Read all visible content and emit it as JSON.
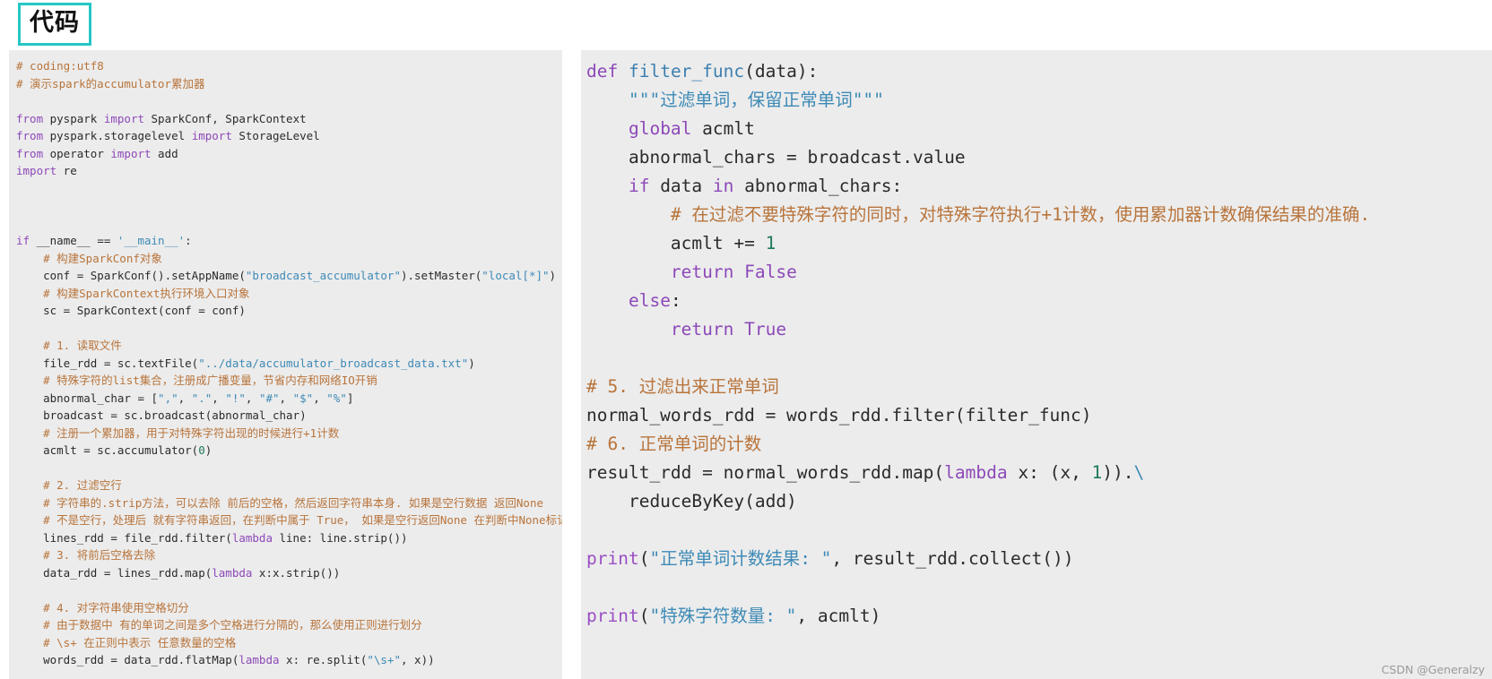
{
  "heading": {
    "badge_label": "代码",
    "border_color": "#26c6c6"
  },
  "theme": {
    "panel_background": "#ececec",
    "page_background": "#ffffff",
    "comment_color": "#b8743b",
    "keyword_color": "#8d49b8",
    "string_color": "#3e8ab6",
    "number_color": "#1f7a5a",
    "function_color": "#3d7fb0",
    "text_color": "#2b2b2b",
    "watermark_color": "#9a9a9a"
  },
  "left_panel": {
    "name": "code-panel-left",
    "language": "python",
    "lines": [
      [
        {
          "t": "# coding:utf8",
          "c": "cmt"
        }
      ],
      [
        {
          "t": "# 演示spark的accumulator累加器",
          "c": "cmt"
        }
      ],
      [],
      [
        {
          "t": "from",
          "c": "kw"
        },
        {
          "t": " pyspark ",
          "c": "plain"
        },
        {
          "t": "import",
          "c": "kw"
        },
        {
          "t": " SparkConf, SparkContext",
          "c": "plain"
        }
      ],
      [
        {
          "t": "from",
          "c": "kw"
        },
        {
          "t": " pyspark.storagelevel ",
          "c": "plain"
        },
        {
          "t": "import",
          "c": "kw"
        },
        {
          "t": " StorageLevel",
          "c": "plain"
        }
      ],
      [
        {
          "t": "from",
          "c": "kw"
        },
        {
          "t": " operator ",
          "c": "plain"
        },
        {
          "t": "import",
          "c": "kw"
        },
        {
          "t": " add",
          "c": "plain"
        }
      ],
      [
        {
          "t": "import",
          "c": "kw"
        },
        {
          "t": " re",
          "c": "plain"
        }
      ],
      [],
      [],
      [],
      [
        {
          "t": "if",
          "c": "kw"
        },
        {
          "t": " __name__ == ",
          "c": "plain"
        },
        {
          "t": "'__main__'",
          "c": "str"
        },
        {
          "t": ":",
          "c": "plain"
        }
      ],
      [
        {
          "t": "    # 构建SparkConf对象",
          "c": "cmt"
        }
      ],
      [
        {
          "t": "    conf = SparkConf().setAppName(",
          "c": "plain"
        },
        {
          "t": "\"broadcast_accumulator\"",
          "c": "str"
        },
        {
          "t": ").setMaster(",
          "c": "plain"
        },
        {
          "t": "\"local[*]\"",
          "c": "str"
        },
        {
          "t": ")",
          "c": "plain"
        }
      ],
      [
        {
          "t": "    # 构建SparkContext执行环境入口对象",
          "c": "cmt"
        }
      ],
      [
        {
          "t": "    sc = SparkContext(conf = conf)",
          "c": "plain"
        }
      ],
      [],
      [
        {
          "t": "    # 1. 读取文件",
          "c": "cmt"
        }
      ],
      [
        {
          "t": "    file_rdd = sc.textFile(",
          "c": "plain"
        },
        {
          "t": "\"../data/accumulator_broadcast_data.txt\"",
          "c": "str"
        },
        {
          "t": ")",
          "c": "plain"
        }
      ],
      [
        {
          "t": "    # 特殊字符的list集合，注册成广播变量，节省内存和网络IO开销",
          "c": "cmt"
        }
      ],
      [
        {
          "t": "    abnormal_char = [",
          "c": "plain"
        },
        {
          "t": "\",\"",
          "c": "str"
        },
        {
          "t": ", ",
          "c": "plain"
        },
        {
          "t": "\".\"",
          "c": "str"
        },
        {
          "t": ", ",
          "c": "plain"
        },
        {
          "t": "\"!\"",
          "c": "str"
        },
        {
          "t": ", ",
          "c": "plain"
        },
        {
          "t": "\"#\"",
          "c": "str"
        },
        {
          "t": ", ",
          "c": "plain"
        },
        {
          "t": "\"$\"",
          "c": "str"
        },
        {
          "t": ", ",
          "c": "plain"
        },
        {
          "t": "\"%\"",
          "c": "str"
        },
        {
          "t": "]",
          "c": "plain"
        }
      ],
      [
        {
          "t": "    broadcast = sc.broadcast(abnormal_char)",
          "c": "plain"
        }
      ],
      [
        {
          "t": "    # 注册一个累加器，用于对特殊字符出现的时候进行+1计数",
          "c": "cmt"
        }
      ],
      [
        {
          "t": "    acmlt = sc.accumulator(",
          "c": "plain"
        },
        {
          "t": "0",
          "c": "num"
        },
        {
          "t": ")",
          "c": "plain"
        }
      ],
      [],
      [
        {
          "t": "    # 2. 过滤空行",
          "c": "cmt"
        }
      ],
      [
        {
          "t": "    # 字符串的.strip方法，可以去除 前后的空格，然后返回字符串本身. 如果是空行数据 返回None",
          "c": "cmt"
        }
      ],
      [
        {
          "t": "    # 不是空行，处理后 就有字符串返回，在判断中属于 True， 如果是空行返回None 在判断中None标记为False",
          "c": "cmt"
        }
      ],
      [
        {
          "t": "    lines_rdd = file_rdd.filter(",
          "c": "plain"
        },
        {
          "t": "lambda",
          "c": "kw"
        },
        {
          "t": " line: line.strip())",
          "c": "plain"
        }
      ],
      [
        {
          "t": "    # 3. 将前后空格去除",
          "c": "cmt"
        }
      ],
      [
        {
          "t": "    data_rdd = lines_rdd.map(",
          "c": "plain"
        },
        {
          "t": "lambda",
          "c": "kw"
        },
        {
          "t": " x:x.strip())",
          "c": "plain"
        }
      ],
      [],
      [
        {
          "t": "    # 4. 对字符串使用空格切分",
          "c": "cmt"
        }
      ],
      [
        {
          "t": "    # 由于数据中 有的单词之间是多个空格进行分隔的，那么使用正则进行划分",
          "c": "cmt"
        }
      ],
      [
        {
          "t": "    # \\s+ 在正则中表示 任意数量的空格",
          "c": "cmt"
        }
      ],
      [
        {
          "t": "    words_rdd = data_rdd.flatMap(",
          "c": "plain"
        },
        {
          "t": "lambda",
          "c": "kw"
        },
        {
          "t": " x: re.split(",
          "c": "plain"
        },
        {
          "t": "\"\\s+\"",
          "c": "str"
        },
        {
          "t": ", x))",
          "c": "plain"
        }
      ]
    ]
  },
  "right_panel": {
    "name": "code-panel-right",
    "language": "python",
    "lines": [
      [
        {
          "t": "def",
          "c": "kw"
        },
        {
          "t": " ",
          "c": "plain"
        },
        {
          "t": "filter_func",
          "c": "fn"
        },
        {
          "t": "(data):",
          "c": "plain"
        }
      ],
      [
        {
          "t": "    ",
          "c": "plain"
        },
        {
          "t": "\"\"\"过滤单词，保留正常单词\"\"\"",
          "c": "str"
        }
      ],
      [
        {
          "t": "    ",
          "c": "plain"
        },
        {
          "t": "global",
          "c": "kw"
        },
        {
          "t": " acmlt",
          "c": "plain"
        }
      ],
      [
        {
          "t": "    abnormal_chars = broadcast.value",
          "c": "plain"
        }
      ],
      [
        {
          "t": "    ",
          "c": "plain"
        },
        {
          "t": "if",
          "c": "kw"
        },
        {
          "t": " data ",
          "c": "plain"
        },
        {
          "t": "in",
          "c": "kw"
        },
        {
          "t": " abnormal_chars:",
          "c": "plain"
        }
      ],
      [
        {
          "t": "        # 在过滤不要特殊字符的同时，对特殊字符执行+1计数，使用累加器计数确保结果的准确.",
          "c": "cmt"
        }
      ],
      [
        {
          "t": "        acmlt += ",
          "c": "plain"
        },
        {
          "t": "1",
          "c": "num"
        }
      ],
      [
        {
          "t": "        ",
          "c": "plain"
        },
        {
          "t": "return",
          "c": "kw"
        },
        {
          "t": " ",
          "c": "plain"
        },
        {
          "t": "False",
          "c": "kw"
        }
      ],
      [
        {
          "t": "    ",
          "c": "plain"
        },
        {
          "t": "else",
          "c": "kw"
        },
        {
          "t": ":",
          "c": "plain"
        }
      ],
      [
        {
          "t": "        ",
          "c": "plain"
        },
        {
          "t": "return",
          "c": "kw"
        },
        {
          "t": " ",
          "c": "plain"
        },
        {
          "t": "True",
          "c": "kw"
        }
      ],
      [],
      [
        {
          "t": "# 5. 过滤出来正常单词",
          "c": "cmt"
        }
      ],
      [
        {
          "t": "normal_words_rdd = words_rdd.filter(filter_func)",
          "c": "plain"
        }
      ],
      [
        {
          "t": "# 6. 正常单词的计数",
          "c": "cmt"
        }
      ],
      [
        {
          "t": "result_rdd = normal_words_rdd.map(",
          "c": "plain"
        },
        {
          "t": "lambda",
          "c": "kw"
        },
        {
          "t": " x: (x, ",
          "c": "plain"
        },
        {
          "t": "1",
          "c": "num"
        },
        {
          "t": ")).",
          "c": "plain"
        },
        {
          "t": "\\",
          "c": "str"
        }
      ],
      [
        {
          "t": "    reduceByKey(add)",
          "c": "plain"
        }
      ],
      [],
      [
        {
          "t": "print",
          "c": "bltn"
        },
        {
          "t": "(",
          "c": "plain"
        },
        {
          "t": "\"正常单词计数结果: \"",
          "c": "str"
        },
        {
          "t": ", result_rdd.collect())",
          "c": "plain"
        }
      ],
      [],
      [
        {
          "t": "print",
          "c": "bltn"
        },
        {
          "t": "(",
          "c": "plain"
        },
        {
          "t": "\"特殊字符数量: \"",
          "c": "str"
        },
        {
          "t": ", acmlt)",
          "c": "plain"
        }
      ]
    ]
  },
  "watermark": {
    "text": "CSDN @Generalzy"
  }
}
